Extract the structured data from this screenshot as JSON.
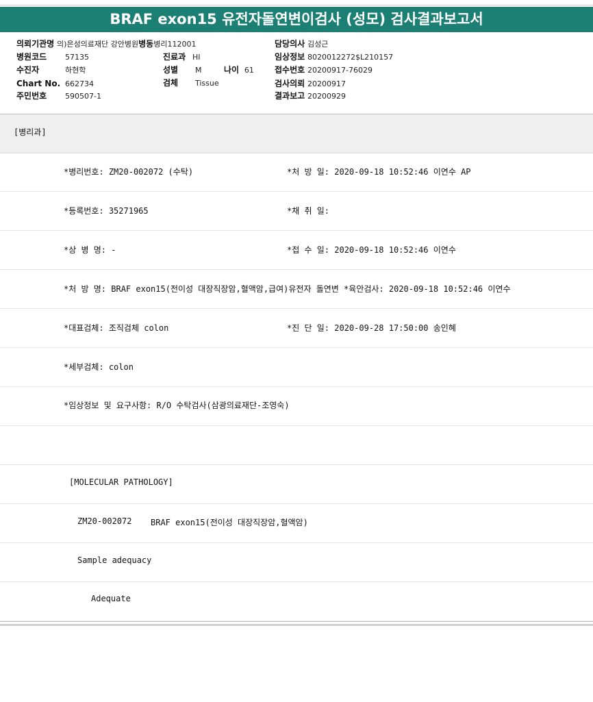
{
  "title": "BRAF exon15 유전자돌연변이검사 (성모) 검사결과보고서",
  "header": {
    "referring_org_label": "의뢰기관명",
    "referring_org_value": "의)은성의료재단 강안병원",
    "ward_label": "병동",
    "ward_value": "병리112001",
    "doctor_label": "담당의사",
    "doctor_value": "김성근",
    "hospital_code_label": "병원코드",
    "hospital_code_value": "57135",
    "dept_label": "진료과",
    "dept_value": "HI",
    "clinical_info_label": "임상정보",
    "clinical_info_value": "8020012272$L210157",
    "patient_label": "수진자",
    "patient_value": "하현학",
    "sex_label": "성별",
    "sex_value": "M",
    "age_label": "나이",
    "age_value": "61",
    "receipt_no_label": "접수번호",
    "receipt_no_value": "20200917-76029",
    "chart_label": "Chart No.",
    "chart_value": "662734",
    "specimen_label": "검체",
    "specimen_value": "Tissue",
    "request_date_label": "검사의뢰",
    "request_date_value": "20200917",
    "id_label": "주민번호",
    "id_value": "590507-1",
    "report_date_label": "결과보고",
    "report_date_value": "20200929"
  },
  "section_label": "[병리과]",
  "details": {
    "row1_left": "*병리번호: ZM20-002072 (수탁)",
    "row1_right": "*처 방 일: 2020-09-18 10:52:46  이연수 AP",
    "row2_left": "*등록번호: 35271965",
    "row2_right": "*채 취 일:",
    "row3_left": "*상 병 명: -",
    "row3_right": "*접 수 일: 2020-09-18 10:52:46  이연수",
    "row4": "*처 방 명: BRAF exon15(전이성 대장직장암,혈액암,급여)유전자 돌연변  *육안검사: 2020-09-18 10:52:46  이연수",
    "row5_left": "*대표검체: 조직검체 colon",
    "row5_right": "*진 단 일: 2020-09-28 17:50:00  송인혜",
    "row6": "*세부검체: colon",
    "row7": "*임상정보 및 요구사항: R/O 수탁검사(삼광의료재단-조영숙)"
  },
  "report": {
    "section": "[MOLECULAR PATHOLOGY]",
    "case_id": "ZM20-002072",
    "test_name": "BRAF exon15(전이성 대장직장암,혈액암)",
    "adequacy_label": "Sample adequacy",
    "adequacy_value": "Adequate"
  },
  "colors": {
    "banner": "#1b7f73",
    "section_bg": "#efefef"
  }
}
